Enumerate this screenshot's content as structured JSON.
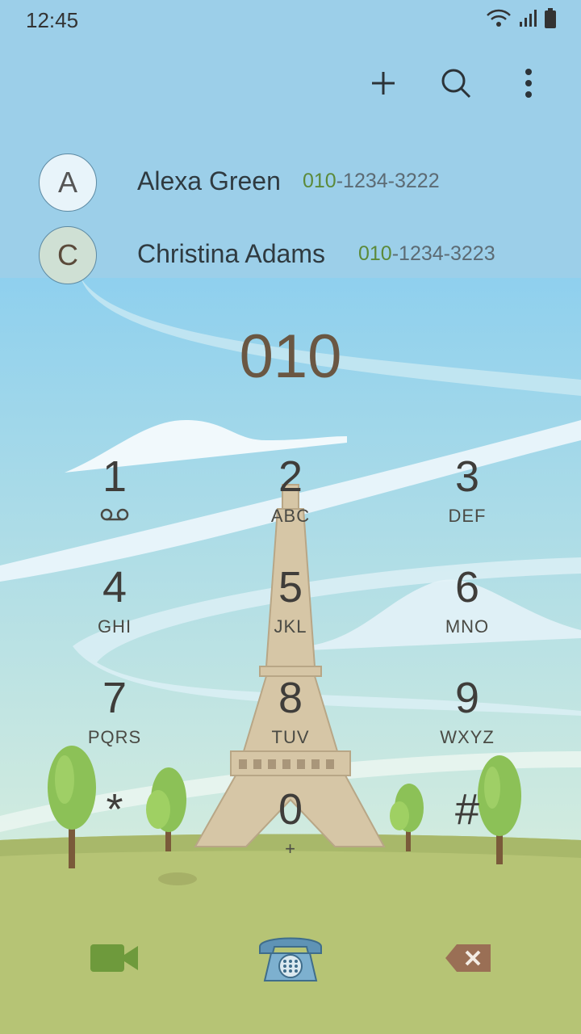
{
  "status_bar": {
    "time": "12:45"
  },
  "top_actions": {
    "add_icon": "plus-icon",
    "search_icon": "search-icon",
    "more_icon": "more-vertical-icon"
  },
  "contacts": [
    {
      "initial": "A",
      "name": "Alexa Green",
      "number_match": "010",
      "number_rest": "-1234-3222"
    },
    {
      "initial": "C",
      "name": "Christina Adams",
      "number_match": "010",
      "number_rest": "-1234-3223"
    }
  ],
  "dialed_number": "010",
  "keypad": [
    {
      "digit": "1",
      "letters": ""
    },
    {
      "digit": "2",
      "letters": "ABC"
    },
    {
      "digit": "3",
      "letters": "DEF"
    },
    {
      "digit": "4",
      "letters": "GHI"
    },
    {
      "digit": "5",
      "letters": "JKL"
    },
    {
      "digit": "6",
      "letters": "MNO"
    },
    {
      "digit": "7",
      "letters": "PQRS"
    },
    {
      "digit": "8",
      "letters": "TUV"
    },
    {
      "digit": "9",
      "letters": "WXYZ"
    },
    {
      "digit": "*",
      "letters": ""
    },
    {
      "digit": "0",
      "letters": "+"
    },
    {
      "digit": "#",
      "letters": ""
    }
  ],
  "bottom_bar": {
    "video_icon": "video-call-icon",
    "call_icon": "phone-call-icon",
    "delete_icon": "backspace-icon"
  },
  "colors": {
    "sky": "#9fd3ea",
    "grass": "#b5c474",
    "tower": "#d8c7a8",
    "tree": "#8cc157"
  }
}
